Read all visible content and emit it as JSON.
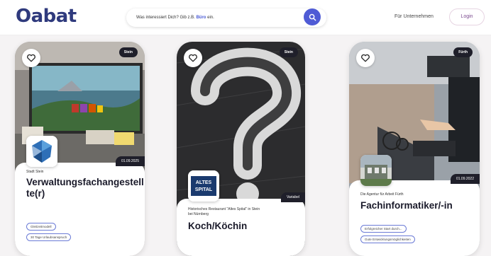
{
  "header": {
    "logo": "Oabat",
    "search_placeholder_pre": "Was interessiert Dich? Gib z.B. ",
    "search_highlight": "Büro",
    "search_placeholder_post": " ein.",
    "nav_link": "Für Unternehmen",
    "login_label": "Login"
  },
  "colors": {
    "brand": "#2f3a7d",
    "accent": "#4f5bd5",
    "tag_border": "#6b7bd6"
  },
  "cards": [
    {
      "location": "Stein",
      "date": "01.09.2025",
      "employer": "Stadt Stein",
      "title_line1": "Verwaltungsfachangestell",
      "title_line2": "te(r)",
      "tags": [
        "Gleitzeitmodell",
        "30 Tage Urlaubsanspruch"
      ]
    },
    {
      "location": "Stein",
      "date": "Variabel",
      "employer_line1": "Historisches Restaurant \"Altes Spital\" in Stein",
      "employer_line2": "bei Nürnberg",
      "title": "Koch/Köchin",
      "logo_text_top": "ALTES",
      "logo_text_bottom": "SPITAL"
    },
    {
      "location": "Fürth",
      "date": "01.09.2022",
      "employer": "Die Agentur für Arbeit Fürth",
      "title": "Fachinformatiker/-in",
      "tags": [
        "Erfolgreicher Start durch...",
        "Gute Entwicklungsmöglichkeiten"
      ]
    }
  ]
}
